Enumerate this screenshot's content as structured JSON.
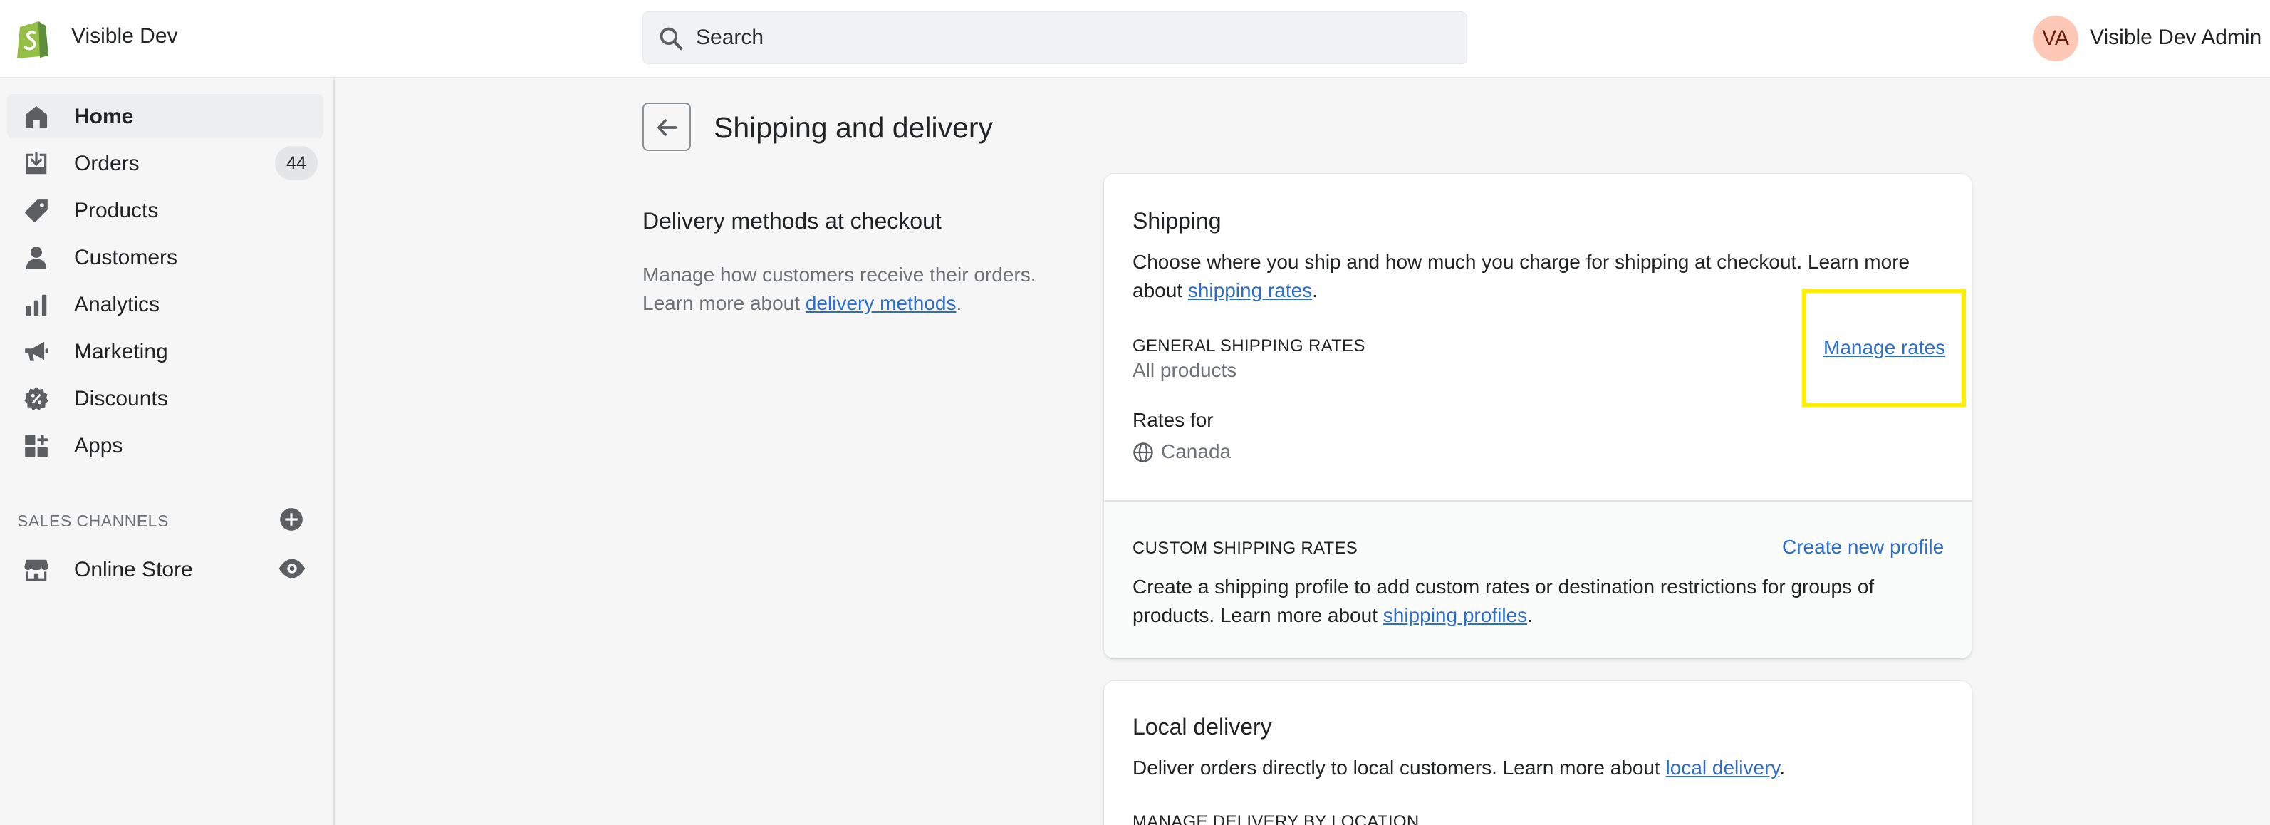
{
  "header": {
    "store_name": "Visible Dev",
    "search_placeholder": "Search",
    "avatar_initials": "VA",
    "admin_name": "Visible Dev Admin"
  },
  "sidebar": {
    "items": [
      {
        "label": "Home",
        "icon": "home-icon"
      },
      {
        "label": "Orders",
        "icon": "orders-icon",
        "badge": "44"
      },
      {
        "label": "Products",
        "icon": "tag-icon"
      },
      {
        "label": "Customers",
        "icon": "person-icon"
      },
      {
        "label": "Analytics",
        "icon": "bar-chart-icon"
      },
      {
        "label": "Marketing",
        "icon": "megaphone-icon"
      },
      {
        "label": "Discounts",
        "icon": "discount-icon"
      },
      {
        "label": "Apps",
        "icon": "apps-icon"
      }
    ],
    "sales_channels_label": "SALES CHANNELS",
    "online_store_label": "Online Store"
  },
  "page": {
    "title": "Shipping and delivery"
  },
  "delivery_methods": {
    "heading": "Delivery methods at checkout",
    "desc_1": "Manage how customers receive their orders.",
    "desc_2": "Learn more about",
    "desc_link": "delivery methods",
    "desc_end": "."
  },
  "shipping_card": {
    "title": "Shipping",
    "desc_1": "Choose where you ship and how much you charge for shipping at checkout. Learn more about",
    "desc_link": "shipping rates",
    "desc_end": ".",
    "general_label": "GENERAL SHIPPING RATES",
    "general_sub": "All products",
    "manage_rates": "Manage rates",
    "rates_for": "Rates for",
    "country": "Canada",
    "custom_label": "CUSTOM SHIPPING RATES",
    "create_profile": "Create new profile",
    "custom_desc": "Create a shipping profile to add custom rates or destination restrictions for groups of products. Learn more about",
    "custom_link": "shipping profiles",
    "custom_end": "."
  },
  "local_card": {
    "title": "Local delivery",
    "desc": "Deliver orders directly to local customers. Learn more about",
    "desc_link": "local delivery",
    "desc_end": ".",
    "manage_label": "MANAGE DELIVERY BY LOCATION"
  },
  "colors": {
    "link": "#2c6ecb",
    "highlight": "#ffee00",
    "logo_green": "#95bf47"
  }
}
